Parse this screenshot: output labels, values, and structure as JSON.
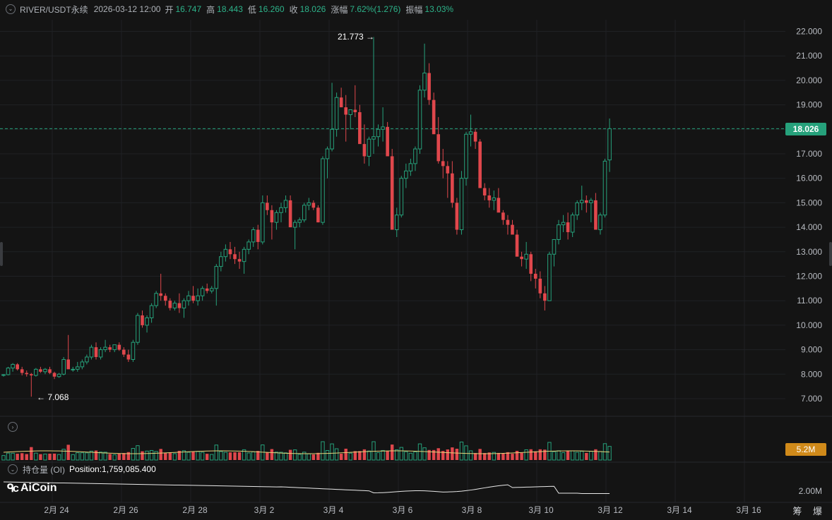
{
  "header": {
    "symbol": "RIVER/USDT永续",
    "datetime": "2026-03-12 12:00",
    "open_label": "开",
    "open": "16.747",
    "high_label": "高",
    "high": "18.443",
    "low_label": "低",
    "low": "16.260",
    "close_label": "收",
    "close": "18.026",
    "change_label": "涨幅",
    "change": "7.62%(1.276)",
    "amplitude_label": "振幅",
    "amplitude": "13.03%"
  },
  "price_axis": {
    "ticks": [
      "22.000",
      "21.000",
      "20.000",
      "19.000",
      "18.000",
      "17.000",
      "16.000",
      "15.000",
      "14.000",
      "13.000",
      "12.000",
      "11.000",
      "10.000",
      "9.000",
      "8.000",
      "7.000"
    ],
    "current_price": "18.026"
  },
  "annotations": {
    "high_marker": "21.773",
    "low_marker": "7.068"
  },
  "volume": {
    "current_label": "5.2M"
  },
  "open_interest": {
    "label": "持仓量 (OI)",
    "position": "Position:1,759,085.400",
    "axis_label": "2.00M"
  },
  "time_axis": [
    "2月 24",
    "2月 26",
    "2月 28",
    "3月 2",
    "3月 4",
    "3月 6",
    "3月 8",
    "3月 10",
    "3月 12",
    "3月 14",
    "3月 16"
  ],
  "brand": {
    "logo_text": "AiCoin"
  },
  "watermark": "筹 爆",
  "colors": {
    "up": "#26a17b",
    "down": "#e0474c",
    "background": "#141414",
    "grid": "#1f2124"
  },
  "chart_data": {
    "type": "candlestick",
    "interval": "4h",
    "ylim": [
      6.6,
      22.5
    ],
    "candles": [
      [
        7.95,
        8.0,
        7.9,
        7.98
      ],
      [
        7.98,
        8.3,
        7.95,
        8.25
      ],
      [
        8.25,
        8.45,
        8.1,
        8.4
      ],
      [
        8.4,
        8.45,
        8.15,
        8.2
      ],
      [
        8.2,
        8.3,
        7.95,
        8.05
      ],
      [
        8.05,
        8.15,
        7.9,
        8.0
      ],
      [
        8.0,
        8.05,
        7.08,
        7.95
      ],
      [
        7.95,
        8.25,
        7.9,
        8.2
      ],
      [
        8.2,
        8.3,
        8.05,
        8.1
      ],
      [
        8.1,
        8.25,
        8.0,
        8.2
      ],
      [
        8.2,
        8.3,
        8.0,
        8.05
      ],
      [
        8.05,
        8.1,
        7.8,
        7.9
      ],
      [
        7.9,
        8.05,
        7.85,
        8.0
      ],
      [
        8.0,
        8.7,
        7.95,
        8.6
      ],
      [
        8.6,
        9.6,
        8.3,
        8.2
      ],
      [
        8.2,
        8.3,
        8.1,
        8.2
      ],
      [
        8.2,
        8.5,
        8.1,
        8.3
      ],
      [
        8.3,
        8.6,
        8.2,
        8.5
      ],
      [
        8.5,
        8.8,
        8.4,
        8.7
      ],
      [
        8.7,
        9.2,
        8.6,
        9.1
      ],
      [
        9.1,
        9.3,
        8.6,
        8.7
      ],
      [
        8.7,
        9.1,
        8.6,
        9.0
      ],
      [
        9.0,
        9.4,
        8.9,
        9.1
      ],
      [
        9.1,
        9.2,
        8.9,
        9.0
      ],
      [
        9.0,
        9.1,
        8.9,
        9.2
      ],
      [
        9.2,
        9.3,
        8.95,
        9.0
      ],
      [
        9.0,
        9.1,
        8.7,
        8.8
      ],
      [
        8.8,
        9.0,
        8.5,
        8.6
      ],
      [
        8.6,
        9.4,
        8.5,
        9.3
      ],
      [
        9.3,
        10.5,
        9.2,
        10.4
      ],
      [
        10.4,
        10.6,
        9.9,
        10.0
      ],
      [
        10.0,
        10.4,
        9.7,
        10.3
      ],
      [
        10.3,
        10.9,
        10.1,
        10.8
      ],
      [
        10.8,
        11.4,
        10.7,
        11.3
      ],
      [
        11.3,
        12.1,
        11.0,
        11.2
      ],
      [
        11.2,
        11.3,
        10.8,
        11.0
      ],
      [
        11.0,
        11.1,
        10.6,
        10.7
      ],
      [
        10.7,
        11.0,
        10.6,
        10.9
      ],
      [
        10.9,
        11.3,
        10.5,
        10.7
      ],
      [
        10.7,
        11.1,
        10.3,
        11.0
      ],
      [
        11.0,
        11.4,
        10.8,
        11.2
      ],
      [
        11.2,
        11.6,
        10.9,
        11.0
      ],
      [
        11.0,
        11.5,
        10.8,
        11.2
      ],
      [
        11.2,
        11.6,
        11.0,
        11.5
      ],
      [
        11.5,
        11.7,
        11.3,
        11.4
      ],
      [
        11.4,
        11.6,
        11.3,
        11.5
      ],
      [
        11.5,
        12.5,
        10.8,
        12.4
      ],
      [
        12.4,
        13.0,
        12.2,
        12.8
      ],
      [
        12.8,
        13.3,
        12.6,
        13.1
      ],
      [
        13.1,
        13.4,
        12.7,
        12.9
      ],
      [
        12.9,
        13.2,
        12.5,
        12.7
      ],
      [
        12.7,
        13.0,
        12.3,
        12.6
      ],
      [
        12.6,
        13.2,
        12.1,
        13.1
      ],
      [
        13.1,
        13.5,
        12.9,
        13.4
      ],
      [
        13.4,
        14.0,
        13.2,
        13.9
      ],
      [
        13.9,
        14.1,
        13.1,
        13.4
      ],
      [
        13.4,
        15.3,
        13.3,
        15.0
      ],
      [
        15.0,
        15.3,
        14.5,
        14.7
      ],
      [
        14.7,
        14.9,
        13.5,
        14.2
      ],
      [
        14.2,
        14.7,
        13.9,
        14.6
      ],
      [
        14.6,
        15.0,
        14.2,
        14.8
      ],
      [
        14.8,
        15.3,
        14.6,
        15.1
      ],
      [
        15.1,
        15.3,
        14.0,
        14.0
      ],
      [
        14.0,
        14.3,
        13.1,
        14.2
      ],
      [
        14.2,
        14.4,
        14.0,
        14.3
      ],
      [
        14.3,
        15.0,
        14.2,
        14.9
      ],
      [
        14.9,
        15.2,
        14.7,
        15.0
      ],
      [
        15.0,
        15.1,
        14.7,
        14.8
      ],
      [
        14.8,
        14.9,
        14.2,
        14.2
      ],
      [
        14.2,
        16.9,
        14.1,
        16.8
      ],
      [
        16.8,
        17.3,
        16.0,
        17.2
      ],
      [
        17.2,
        19.9,
        17.1,
        18.0
      ],
      [
        18.0,
        19.5,
        17.7,
        19.3
      ],
      [
        19.3,
        19.7,
        19.0,
        18.9
      ],
      [
        18.9,
        19.4,
        17.5,
        18.6
      ],
      [
        18.6,
        18.8,
        18.0,
        18.8
      ],
      [
        18.8,
        19.8,
        18.5,
        18.7
      ],
      [
        18.7,
        19.0,
        17.7,
        17.4
      ],
      [
        17.4,
        18.2,
        16.6,
        16.9
      ],
      [
        16.9,
        17.7,
        16.5,
        17.6
      ],
      [
        17.6,
        21.77,
        17.0,
        17.7
      ],
      [
        17.7,
        18.2,
        17.3,
        18.0
      ],
      [
        18.0,
        18.9,
        17.5,
        18.1
      ],
      [
        18.1,
        18.3,
        17.0,
        16.9
      ],
      [
        16.9,
        17.2,
        14.6,
        13.9
      ],
      [
        13.9,
        14.8,
        13.6,
        14.5
      ],
      [
        14.5,
        16.1,
        14.4,
        16.0
      ],
      [
        16.0,
        16.6,
        15.6,
        16.3
      ],
      [
        16.3,
        16.8,
        16.1,
        16.6
      ],
      [
        16.6,
        17.3,
        16.3,
        17.2
      ],
      [
        17.2,
        19.8,
        17.0,
        19.6
      ],
      [
        19.6,
        21.5,
        19.3,
        20.3
      ],
      [
        20.3,
        20.7,
        19.0,
        19.2
      ],
      [
        19.2,
        19.5,
        17.9,
        17.8
      ],
      [
        17.8,
        18.5,
        16.6,
        16.7
      ],
      [
        16.7,
        17.2,
        16.0,
        16.5
      ],
      [
        16.5,
        16.7,
        15.2,
        16.2
      ],
      [
        16.2,
        16.7,
        14.8,
        15.0
      ],
      [
        15.0,
        15.2,
        13.7,
        13.9
      ],
      [
        13.9,
        16.3,
        13.7,
        16.0
      ],
      [
        16.0,
        17.9,
        15.7,
        17.8
      ],
      [
        17.8,
        18.6,
        17.3,
        17.9
      ],
      [
        17.9,
        18.0,
        17.2,
        17.5
      ],
      [
        17.5,
        17.6,
        15.9,
        15.6
      ],
      [
        15.6,
        15.8,
        15.1,
        15.3
      ],
      [
        15.3,
        15.6,
        14.8,
        15.1
      ],
      [
        15.1,
        15.5,
        14.7,
        15.2
      ],
      [
        15.2,
        15.6,
        14.9,
        14.6
      ],
      [
        14.6,
        14.7,
        14.1,
        14.3
      ],
      [
        14.3,
        14.5,
        13.7,
        14.1
      ],
      [
        14.1,
        14.3,
        13.8,
        13.7
      ],
      [
        13.7,
        13.9,
        12.9,
        12.8
      ],
      [
        12.8,
        13.0,
        12.4,
        12.7
      ],
      [
        12.7,
        13.4,
        12.3,
        12.9
      ],
      [
        12.9,
        13.0,
        11.8,
        12.1
      ],
      [
        12.1,
        12.3,
        11.5,
        11.9
      ],
      [
        11.9,
        12.2,
        11.1,
        11.3
      ],
      [
        11.3,
        11.6,
        10.6,
        11.0
      ],
      [
        11.0,
        13.0,
        11.0,
        12.9
      ],
      [
        12.9,
        13.2,
        12.4,
        13.5
      ],
      [
        13.5,
        14.3,
        13.3,
        14.1
      ],
      [
        14.1,
        14.5,
        13.8,
        14.2
      ],
      [
        14.2,
        14.6,
        13.5,
        13.8
      ],
      [
        13.8,
        14.6,
        13.6,
        14.5
      ],
      [
        14.5,
        15.1,
        14.3,
        15.0
      ],
      [
        15.0,
        15.7,
        14.7,
        15.1
      ],
      [
        15.1,
        15.3,
        14.6,
        15.0
      ],
      [
        15.0,
        15.2,
        14.2,
        15.1
      ],
      [
        15.1,
        15.4,
        14.0,
        13.9
      ],
      [
        13.9,
        14.6,
        13.7,
        14.5
      ],
      [
        14.5,
        16.8,
        14.4,
        16.7
      ],
      [
        16.75,
        18.443,
        16.26,
        18.026
      ]
    ],
    "volume_ma_color": "#e6d37a",
    "oi_line_color": "#e8e8e8"
  }
}
